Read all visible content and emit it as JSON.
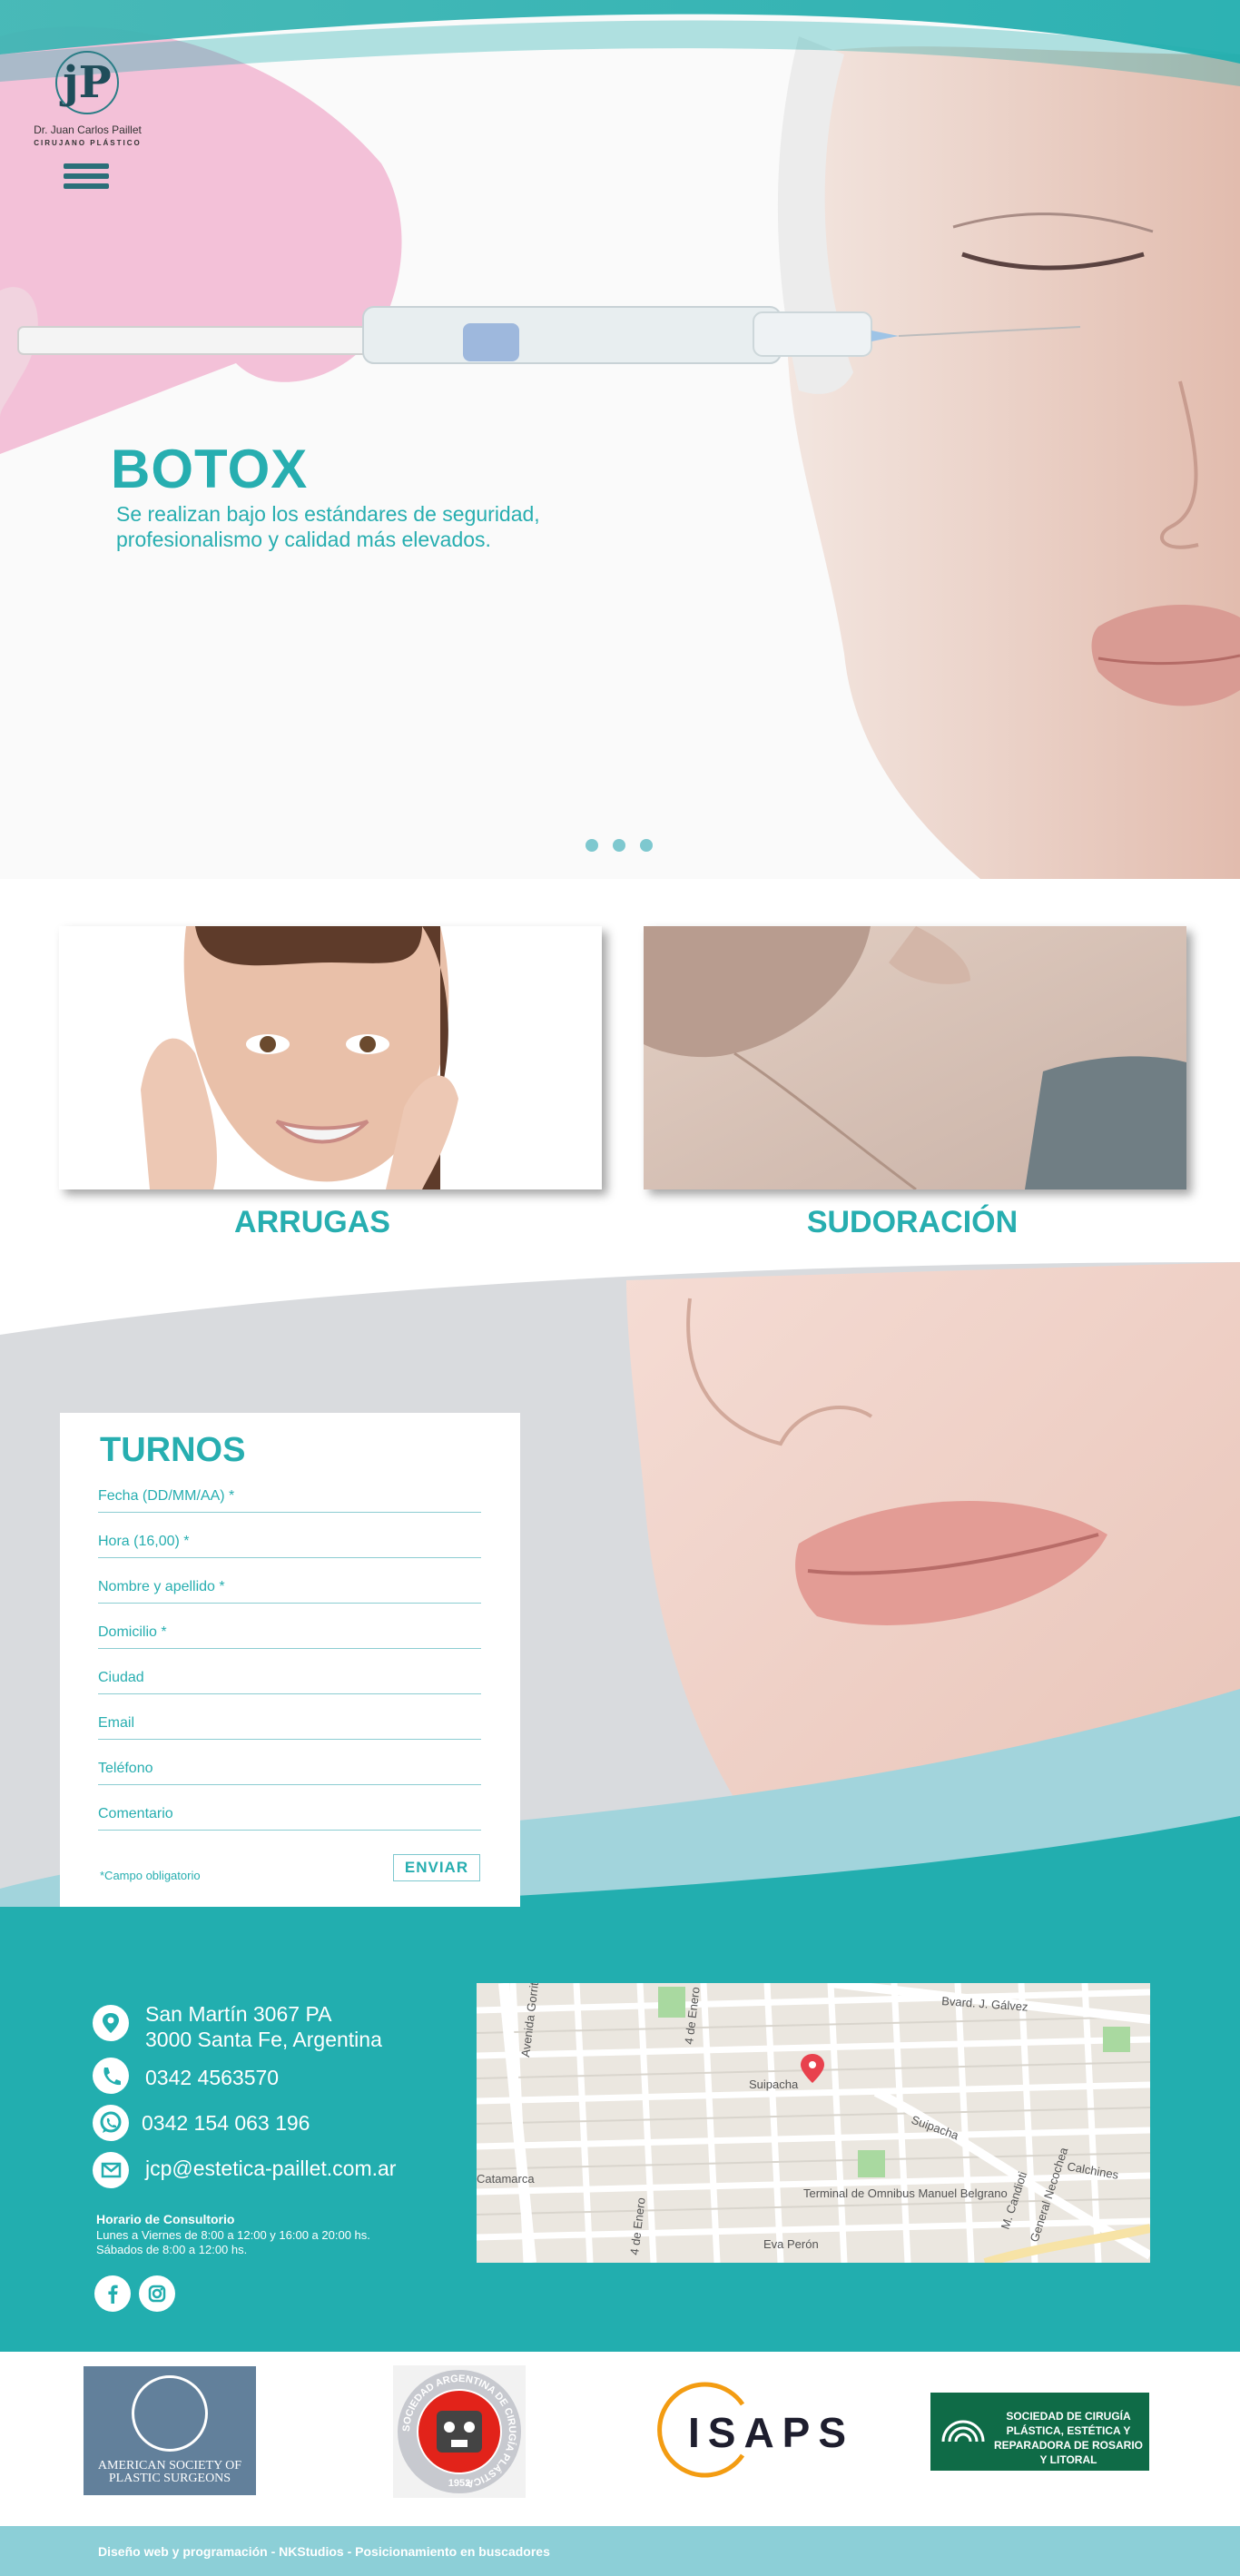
{
  "logo": {
    "monogram": "jP",
    "name": "Dr. Juan Carlos Paillet",
    "subtitle": "CIRUJANO PLÁSTICO"
  },
  "hero": {
    "title": "BOTOX",
    "lead": "Se realizan bajo los estándares de seguridad, profesionalismo y calidad más elevados.",
    "slides": 3
  },
  "services": [
    {
      "label": "ARRUGAS"
    },
    {
      "label": "SUDORACIÓN"
    }
  ],
  "form": {
    "title": "TURNOS",
    "fields": [
      {
        "placeholder": "Fecha (DD/MM/AA) *"
      },
      {
        "placeholder": "Hora (16,00) *"
      },
      {
        "placeholder": "Nombre y apellido *"
      },
      {
        "placeholder": "Domicilio *"
      },
      {
        "placeholder": "Ciudad"
      },
      {
        "placeholder": "Email"
      },
      {
        "placeholder": "Teléfono"
      },
      {
        "placeholder": "Comentario"
      }
    ],
    "required_note": "*Campo obligatorio",
    "submit_label": "ENVIAR"
  },
  "contact": {
    "address_line1": "San Martín 3067 PA",
    "address_line2": "3000 Santa Fe, Argentina",
    "phone": "0342 4563570",
    "whatsapp": "0342 154 063 196",
    "email": "jcp@estetica-paillet.com.ar",
    "hours_title": "Horario de Consultorio",
    "hours_line1": "Lunes a Viernes de 8:00 a 12:00 y 16:00 a 20:00 hs.",
    "hours_line2": "Sábados de 8:00 a 12:00 hs."
  },
  "map": {
    "labels": [
      "Avenida Gorriti",
      "4 de Enero",
      "Suipacha",
      "Suipacha",
      "Bvard. J. Gálvez",
      "Terminal de Omnibus Manuel Belgrano",
      "Catamarca",
      "Eva Perón",
      "Calchines",
      "M. Candioti",
      "General Necochea",
      "4 de Enero"
    ]
  },
  "partners": {
    "asps": "AMERICAN SOCIETY OF PLASTIC SURGEONS",
    "sacp_ring": "SOCIEDAD ARGENTINA DE CIRUGÍA PLÁSTICA",
    "sacp_year": "1952",
    "isaps": "ISAPS",
    "scp": "SOCIEDAD DE CIRUGÍA PLÁSTICA, ESTÉTICA Y REPARADORA DE ROSARIO Y LITORAL"
  },
  "footer": {
    "text": "Diseño web y programación - NKStudios - Posicionamiento en buscadores"
  },
  "colors": {
    "accent": "#27aeb0",
    "teal_dark": "#22aeaf",
    "footer": "#8ccfd7"
  }
}
